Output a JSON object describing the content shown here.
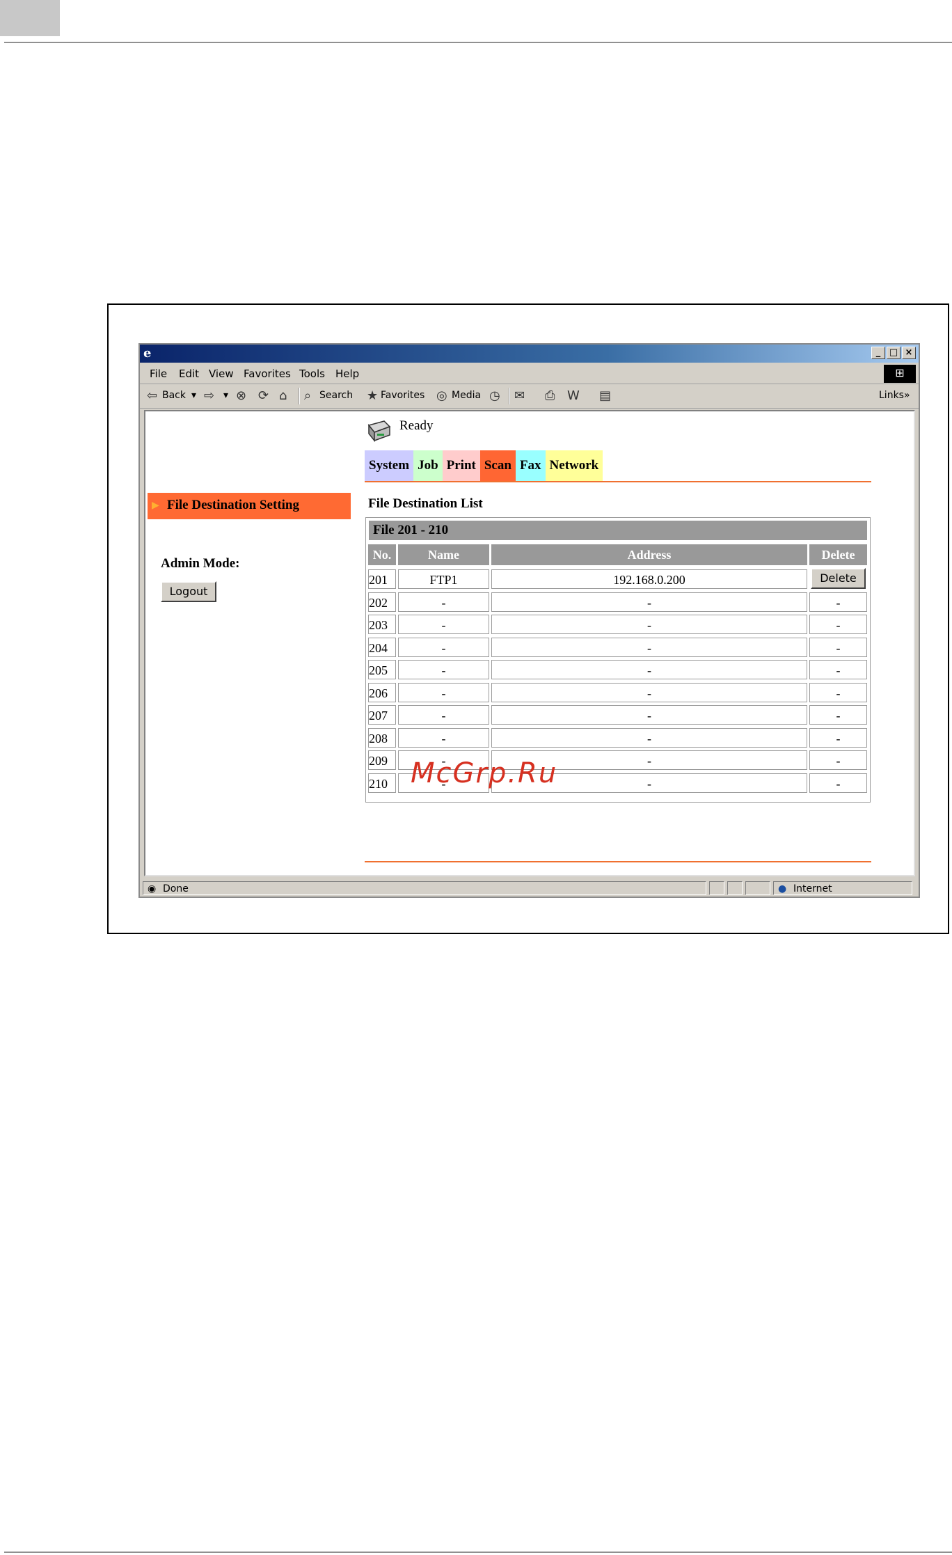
{
  "browser": {
    "menu": [
      "File",
      "Edit",
      "View",
      "Favorites",
      "Tools",
      "Help"
    ],
    "toolbar": {
      "back": "Back",
      "search": "Search",
      "favorites": "Favorites",
      "media": "Media",
      "links": "Links"
    },
    "status": {
      "left": "Done",
      "zone": "Internet"
    }
  },
  "page": {
    "status": "Ready",
    "tabs": [
      {
        "label": "System",
        "color": "#ccccff"
      },
      {
        "label": "Job",
        "color": "#ccffcc"
      },
      {
        "label": "Print",
        "color": "#ffcccc"
      },
      {
        "label": "Scan",
        "color": "#ff6633"
      },
      {
        "label": "Fax",
        "color": "#99ffff"
      },
      {
        "label": "Network",
        "color": "#ffff99"
      }
    ],
    "sidebar": {
      "selected": "File Destination Setting",
      "admin_label": "Admin Mode:",
      "logout": "Logout"
    },
    "list_title": "File Destination List",
    "range_title": "File 201 - 210",
    "columns": [
      "No.",
      "Name",
      "Address",
      "Delete"
    ],
    "rows": [
      {
        "no": "201",
        "name": "FTP1",
        "address": "192.168.0.200",
        "delete": "Delete"
      },
      {
        "no": "202",
        "name": "-",
        "address": "-",
        "delete": "-"
      },
      {
        "no": "203",
        "name": "-",
        "address": "-",
        "delete": "-"
      },
      {
        "no": "204",
        "name": "-",
        "address": "-",
        "delete": "-"
      },
      {
        "no": "205",
        "name": "-",
        "address": "-",
        "delete": "-"
      },
      {
        "no": "206",
        "name": "-",
        "address": "-",
        "delete": "-"
      },
      {
        "no": "207",
        "name": "-",
        "address": "-",
        "delete": "-"
      },
      {
        "no": "208",
        "name": "-",
        "address": "-",
        "delete": "-"
      },
      {
        "no": "209",
        "name": "-",
        "address": "-",
        "delete": "-"
      },
      {
        "no": "210",
        "name": "-",
        "address": "-",
        "delete": "-"
      }
    ]
  },
  "watermark": "McGrp.Ru"
}
